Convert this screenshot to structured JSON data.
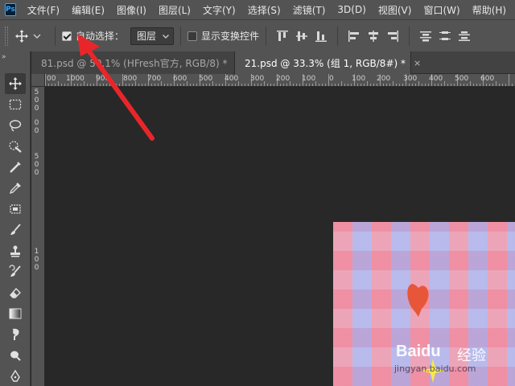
{
  "app": {
    "logo": "Ps"
  },
  "menu": [
    "文件(F)",
    "编辑(E)",
    "图像(I)",
    "图层(L)",
    "文字(Y)",
    "选择(S)",
    "滤镜(T)",
    "3D(D)",
    "视图(V)",
    "窗口(W)",
    "帮助(H)"
  ],
  "options": {
    "tool_icon": "move-icon",
    "auto_select_label": "自动选择：",
    "auto_select_checked": true,
    "target_value": "图层",
    "transform_controls_label": "显示变换控件",
    "transform_controls_checked": false
  },
  "tabs": [
    {
      "label": "81.psd @ 50.1% (HFresh官方, RGB/8) *",
      "active": false
    },
    {
      "label": "21.psd @ 33.3% (组 1, RGB/8#) *",
      "active": true
    }
  ],
  "tab_close_glyph": "×",
  "ruler": {
    "horizontal": [
      "00",
      "1000",
      "900",
      "800",
      "700",
      "600",
      "500",
      "400",
      "300",
      "200",
      "100",
      "0",
      "100",
      "200",
      "300",
      "400",
      "500",
      "600"
    ],
    "vertical": [
      "5",
      "0",
      "0",
      "0",
      "0",
      "5",
      "0",
      "0",
      "1",
      "0",
      "0"
    ]
  },
  "watermark": {
    "brand": "Baidu",
    "cn": "经验",
    "url": "jingyan.baidu.com"
  },
  "colors": {
    "annotation_arrow": "#e8262a",
    "accent": "#31a8ff"
  }
}
